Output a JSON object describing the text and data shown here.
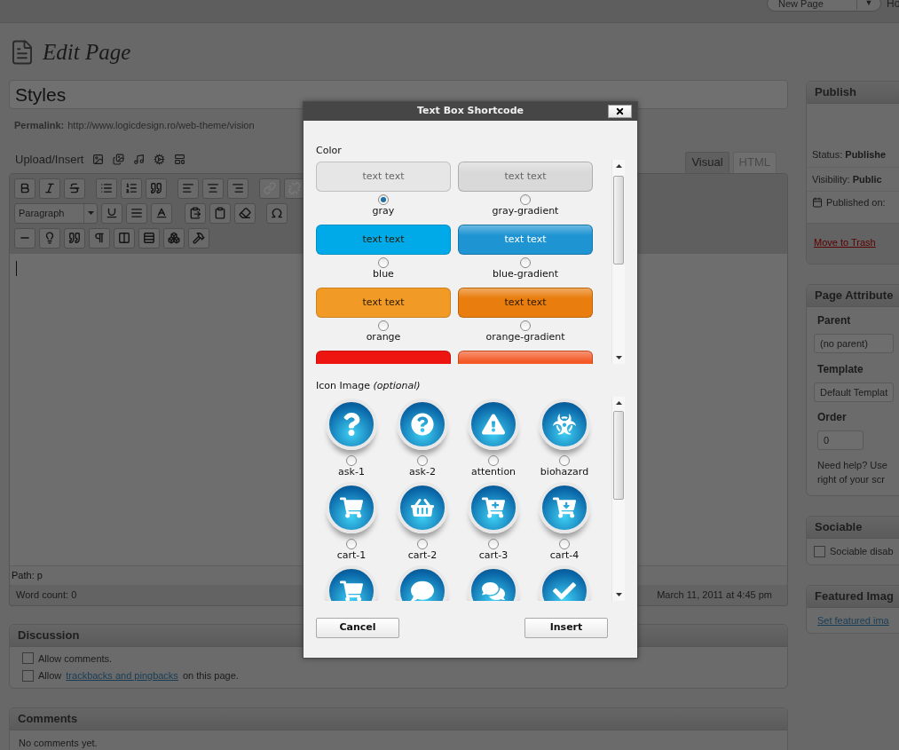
{
  "admin_bar": {
    "new_page_button": "New Page",
    "dropdown_arrow": "▼",
    "next_link": "Ho"
  },
  "heading": "Edit Page",
  "title_field": {
    "value": "Styles"
  },
  "permalink": {
    "label": "Permalink:",
    "url": "http://www.logicdesign.ro/web-theme/vision"
  },
  "upload_insert": "Upload/Insert",
  "editor_tabs": [
    {
      "label": "Visual",
      "selected": true
    },
    {
      "label": "HTML",
      "selected": false
    }
  ],
  "format_select": {
    "value": "Paragraph"
  },
  "path": "Path: p",
  "word_count": "Word count: 0",
  "last_edited": "March 11, 2011 at 4:45 pm",
  "discussion": {
    "title": "Discussion",
    "options": [
      {
        "text": "Allow comments.",
        "checked": false
      },
      {
        "text": "Allow",
        "link": "trackbacks and pingbacks",
        "after": "on this page.",
        "checked": false
      }
    ]
  },
  "comments": {
    "title": "Comments",
    "text": "No comments yet."
  },
  "publish": {
    "title": "Publish",
    "status_label": "Status:",
    "status": "Publishe",
    "visibility_label": "Visibility:",
    "visibility": "Public",
    "published_on": "Published on:",
    "trash": "Move to Trash"
  },
  "page_attributes": {
    "title": "Page Attribute",
    "parent_label": "Parent",
    "parent": "(no parent)",
    "template_label": "Template",
    "template": "Default Templat",
    "order_label": "Order",
    "order": "0",
    "help_lines": [
      "Need help? Use",
      "right of your scr"
    ]
  },
  "sociable": {
    "title": "Sociable",
    "option": {
      "text": "Sociable disab",
      "checked": false
    }
  },
  "featured_image": {
    "title": "Featured Imag",
    "link": "Set featured ima"
  },
  "dialog": {
    "title": "Text Box Shortcode",
    "color_label": "Color",
    "colors": [
      {
        "kind": "flat",
        "text": "text text",
        "label": "gray",
        "selected": true,
        "color": "#e6e6e6"
      },
      {
        "kind": "gradient",
        "text": "text text",
        "label": "gray-gradient",
        "selected": false,
        "color": "#d9d9d9"
      },
      {
        "kind": "flat",
        "text": "text text",
        "label": "blue",
        "selected": false,
        "color": "#00a9e8"
      },
      {
        "kind": "gradient",
        "text": "text text",
        "label": "blue-gradient",
        "selected": false,
        "color": "#1e95d2"
      },
      {
        "kind": "flat",
        "text": "text text",
        "label": "orange",
        "selected": false,
        "color": "#f19a26"
      },
      {
        "kind": "gradient",
        "text": "text text",
        "label": "orange-gradient",
        "selected": false,
        "color": "#e97d0e"
      },
      {
        "kind": "flat",
        "color": "#ee1511"
      },
      {
        "kind": "gradient",
        "color": "#f35a28"
      }
    ],
    "icon_label": "Icon Image *(optional)*",
    "icons": [
      {
        "kind": "full",
        "label": "ask-1",
        "selected": false
      },
      {
        "kind": "full",
        "label": "ask-2",
        "selected": false
      },
      {
        "kind": "full",
        "label": "attention",
        "selected": false
      },
      {
        "kind": "full",
        "label": "biohazard",
        "selected": false
      },
      {
        "kind": "full",
        "label": "cart-1",
        "selected": false
      },
      {
        "kind": "full",
        "label": "cart-2",
        "selected": false
      },
      {
        "kind": "full",
        "label": "cart-3",
        "selected": false
      },
      {
        "kind": "full",
        "label": "cart-4",
        "selected": false
      },
      {
        "kind": "partial"
      },
      {
        "kind": "partial"
      },
      {
        "kind": "partial"
      },
      {
        "kind": "partial"
      }
    ],
    "buttons": [
      "Cancel",
      "Insert"
    ]
  }
}
